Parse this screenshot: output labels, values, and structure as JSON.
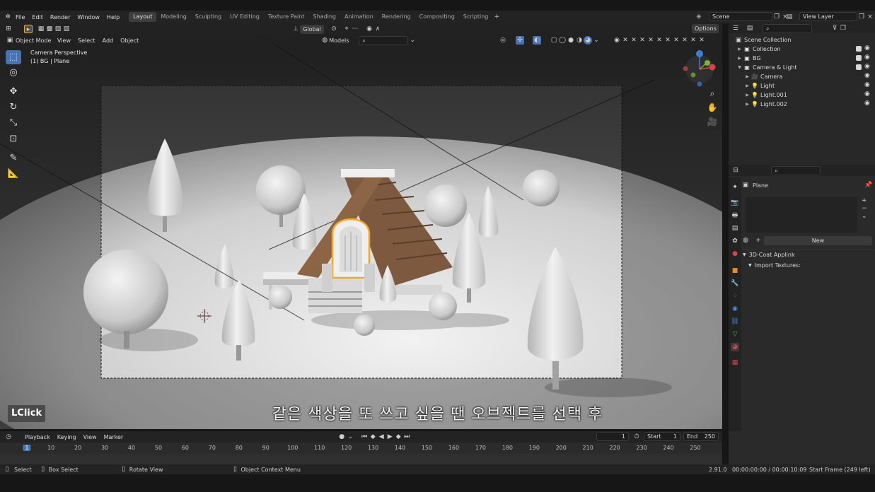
{
  "menu": [
    "File",
    "Edit",
    "Render",
    "Window",
    "Help"
  ],
  "workspaces": [
    "Layout",
    "Modeling",
    "Sculpting",
    "UV Editing",
    "Texture Paint",
    "Shading",
    "Animation",
    "Rendering",
    "Compositing",
    "Scripting"
  ],
  "active_workspace": "Layout",
  "scene_field": "Scene",
  "view_layer_field": "View Layer",
  "viewport": {
    "mode": "Object Mode",
    "menus": [
      "View",
      "Select",
      "Add",
      "Object"
    ],
    "transform_orientation": "Global",
    "snap_target": "Models",
    "options_label": "Options",
    "overlay_title": "Camera Perspective",
    "overlay_subtitle": "(1) BG | Plane"
  },
  "outliner": {
    "root": "Scene Collection",
    "items": [
      {
        "label": "Collection",
        "indent": 1,
        "icon": "collection-icon"
      },
      {
        "label": "BG",
        "indent": 1,
        "icon": "collection-icon"
      },
      {
        "label": "Camera & Light",
        "indent": 1,
        "icon": "collection-icon"
      },
      {
        "label": "Camera",
        "indent": 2,
        "icon": "camera-icon"
      },
      {
        "label": "Light",
        "indent": 2,
        "icon": "light-icon"
      },
      {
        "label": "Light.001",
        "indent": 2,
        "icon": "light-icon"
      },
      {
        "label": "Light.002",
        "indent": 2,
        "icon": "light-icon"
      }
    ]
  },
  "properties": {
    "object_name": "Plane",
    "new_button": "New",
    "panel_title": "3D-Coat Applink",
    "subpanel_title": "Import Textures:"
  },
  "timeline": {
    "menus": [
      "Playback",
      "Keying",
      "View",
      "Marker"
    ],
    "current_frame": "1",
    "start_label": "Start",
    "start_value": "1",
    "end_label": "End",
    "end_value": "250",
    "ticks": [
      "1",
      "10",
      "20",
      "30",
      "40",
      "50",
      "60",
      "70",
      "80",
      "90",
      "100",
      "110",
      "120",
      "130",
      "140",
      "150",
      "160",
      "170",
      "180",
      "190",
      "200",
      "210",
      "220",
      "230",
      "240",
      "250"
    ]
  },
  "status": {
    "select": "Select",
    "box_select": "Box Select",
    "rotate_view": "Rotate View",
    "context_menu": "Object Context Menu",
    "version": "2.91.0",
    "time": "00:00:00:00 / 00:00:10:09",
    "start_frame": "Start Frame (249 left)"
  },
  "subtitle": "같은 색상을 또 쓰고 싶을 땐 오브젝트를 선택 후",
  "lclick_badge": "LClick",
  "colors": {
    "accent": "#4772b3",
    "selection": "#f5a623",
    "header": "#232323",
    "panel": "#2a2a2a"
  }
}
